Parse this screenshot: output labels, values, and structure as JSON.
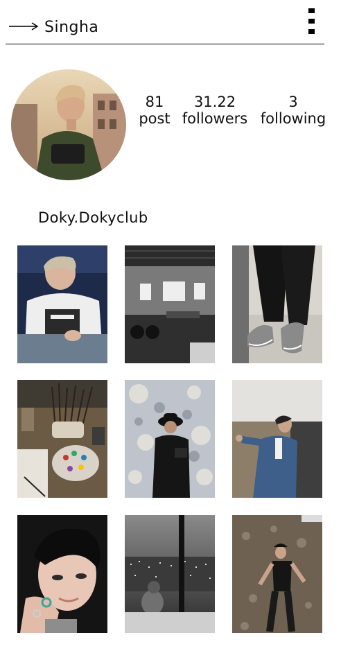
{
  "header": {
    "title": "Singha",
    "back_icon": "arrow-right-icon",
    "menu_icon": "vertical-dots-menu-icon"
  },
  "profile": {
    "username": "Doky.Dokyclub",
    "stats": [
      {
        "value": "81",
        "label": "post"
      },
      {
        "value": "31.22",
        "label": "followers"
      },
      {
        "value": "3",
        "label": "following"
      }
    ]
  },
  "grid": {
    "rows": 3,
    "columns": 3,
    "posts": [
      "photo-man-white-tshirt",
      "photo-industrial-loft-motorcycles",
      "photo-reflective-sneakers",
      "photo-art-brushes-palette",
      "photo-man-hat-camera-shadows",
      "photo-man-blue-denim-suit",
      "photo-closeup-man-rings",
      "photo-city-skyline-night",
      "photo-man-walking-hillside"
    ]
  },
  "colors": {
    "background": "#ffffff",
    "text": "#111111",
    "rule": "#000000"
  }
}
